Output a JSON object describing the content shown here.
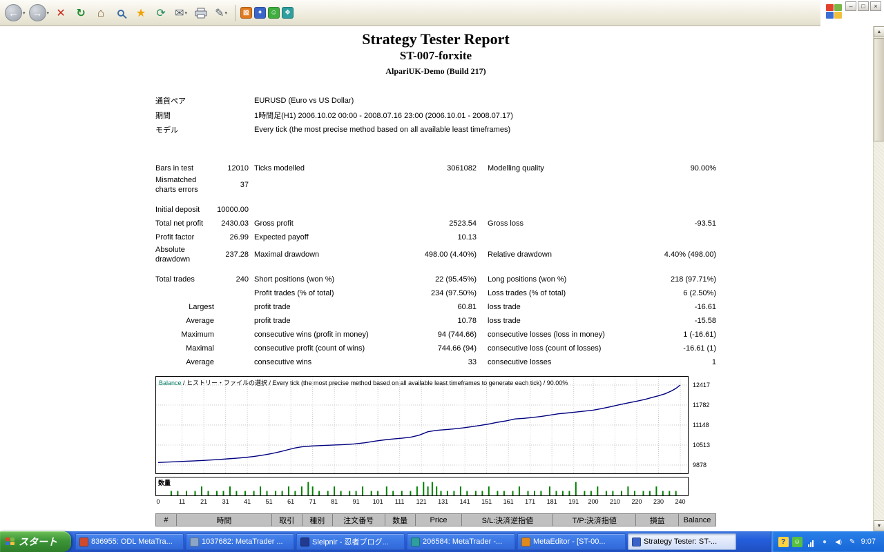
{
  "browser": {
    "toolbar_icons": [
      "back",
      "forward",
      "stop",
      "refresh",
      "home",
      "search",
      "favorites",
      "history",
      "mail",
      "print",
      "edit",
      "plugin-orange",
      "plugin-blue",
      "plugin-green",
      "plugin-teal"
    ],
    "window_controls": [
      "minimize",
      "maximize",
      "close"
    ]
  },
  "report": {
    "title": "Strategy Tester Report",
    "symbol": "ST-007-forxite",
    "server": "AlpariUK-Demo (Build 217)",
    "params": [
      {
        "label": "通貨ペア",
        "value": "EURUSD (Euro vs US Dollar)"
      },
      {
        "label": "期間",
        "value": "1時間足(H1) 2006.10.02 00:00 - 2008.07.16 23:00 (2006.10.01 - 2008.07.17)"
      },
      {
        "label": "モデル",
        "value": "Every tick (the most precise method based on all available least timeframes)"
      }
    ],
    "stats": [
      {
        "cells": [
          "Bars in test",
          "12010",
          "Ticks modelled",
          "3061082",
          "Modelling quality",
          "90.00%"
        ]
      },
      {
        "cells": [
          "Mismatched charts errors",
          "37",
          "",
          "",
          "",
          ""
        ]
      },
      {
        "spacer": true
      },
      {
        "cells": [
          "Initial deposit",
          "10000.00",
          "",
          "",
          "",
          ""
        ]
      },
      {
        "cells": [
          "Total net profit",
          "2430.03",
          "Gross profit",
          "2523.54",
          "Gross loss",
          "-93.51"
        ]
      },
      {
        "cells": [
          "Profit factor",
          "26.99",
          "Expected payoff",
          "10.13",
          "",
          ""
        ]
      },
      {
        "cells": [
          "Absolute drawdown",
          "237.28",
          "Maximal drawdown",
          "498.00 (4.40%)",
          "Relative drawdown",
          "4.40% (498.00)"
        ]
      },
      {
        "spacer": true
      },
      {
        "cells": [
          "Total trades",
          "240",
          "Short positions (won %)",
          "22 (95.45%)",
          "Long positions (won %)",
          "218 (97.71%)"
        ]
      },
      {
        "cells": [
          "",
          "",
          "Profit trades (% of total)",
          "234 (97.50%)",
          "Loss trades (% of total)",
          "6 (2.50%)"
        ]
      },
      {
        "cells": [
          "Largest",
          "",
          "profit trade",
          "60.81",
          "loss trade",
          "-16.61"
        ],
        "label_right": true
      },
      {
        "cells": [
          "Average",
          "",
          "profit trade",
          "10.78",
          "loss trade",
          "-15.58"
        ],
        "label_right": true
      },
      {
        "cells": [
          "Maximum",
          "",
          "consecutive wins (profit in money)",
          "94 (744.66)",
          "consecutive losses (loss in money)",
          "1 (-16.61)"
        ],
        "label_right": true
      },
      {
        "cells": [
          "Maximal",
          "",
          "consecutive profit (count of wins)",
          "744.66 (94)",
          "consecutive loss (count of losses)",
          "-16.61 (1)"
        ],
        "label_right": true
      },
      {
        "cells": [
          "Average",
          "",
          "consecutive wins",
          "33",
          "consecutive losses",
          "1"
        ],
        "label_right": true
      }
    ],
    "trades_header": [
      "#",
      "時間",
      "取引",
      "種別",
      "注文番号",
      "数量",
      "Price",
      "S/L:決済逆指値",
      "T/P:決済指値",
      "損益",
      "Balance"
    ]
  },
  "chart_data": {
    "type": "line",
    "legend_label": "Balance",
    "header_rest": " / ヒストリー・ファイルの選択 / Every tick (the most precise method based on all available least timeframes to generate each tick) / 90.00%",
    "line_color": "#000080",
    "grid": true,
    "ylim": [
      9878,
      12417
    ],
    "xlim": [
      0,
      240
    ],
    "y_ticks": [
      12417,
      11782,
      11148,
      10513,
      9878
    ],
    "x_ticks": [
      0,
      11,
      21,
      31,
      41,
      51,
      61,
      71,
      81,
      91,
      101,
      111,
      121,
      131,
      141,
      151,
      161,
      171,
      181,
      191,
      200,
      210,
      220,
      230,
      240
    ],
    "balance_points": [
      [
        0,
        9960
      ],
      [
        4,
        9972
      ],
      [
        8,
        9984
      ],
      [
        12,
        9996
      ],
      [
        16,
        10008
      ],
      [
        20,
        10022
      ],
      [
        24,
        10038
      ],
      [
        28,
        10055
      ],
      [
        32,
        10075
      ],
      [
        36,
        10095
      ],
      [
        40,
        10118
      ],
      [
        44,
        10150
      ],
      [
        48,
        10190
      ],
      [
        52,
        10240
      ],
      [
        56,
        10300
      ],
      [
        60,
        10370
      ],
      [
        63,
        10420
      ],
      [
        66,
        10455
      ],
      [
        70,
        10480
      ],
      [
        75,
        10498
      ],
      [
        80,
        10510
      ],
      [
        85,
        10525
      ],
      [
        90,
        10548
      ],
      [
        95,
        10585
      ],
      [
        100,
        10640
      ],
      [
        104,
        10678
      ],
      [
        108,
        10705
      ],
      [
        112,
        10730
      ],
      [
        116,
        10760
      ],
      [
        120,
        10825
      ],
      [
        124,
        10935
      ],
      [
        128,
        10980
      ],
      [
        132,
        11000
      ],
      [
        136,
        11025
      ],
      [
        140,
        11055
      ],
      [
        144,
        11095
      ],
      [
        148,
        11135
      ],
      [
        152,
        11180
      ],
      [
        156,
        11235
      ],
      [
        160,
        11280
      ],
      [
        164,
        11340
      ],
      [
        168,
        11360
      ],
      [
        172,
        11385
      ],
      [
        176,
        11420
      ],
      [
        180,
        11460
      ],
      [
        184,
        11505
      ],
      [
        188,
        11530
      ],
      [
        192,
        11560
      ],
      [
        196,
        11590
      ],
      [
        200,
        11620
      ],
      [
        204,
        11670
      ],
      [
        208,
        11730
      ],
      [
        212,
        11790
      ],
      [
        216,
        11850
      ],
      [
        220,
        11905
      ],
      [
        224,
        11965
      ],
      [
        227,
        12020
      ],
      [
        230,
        12075
      ],
      [
        233,
        12140
      ],
      [
        236,
        12230
      ],
      [
        238,
        12310
      ],
      [
        240,
        12417
      ]
    ],
    "volume_label": "数量",
    "volume_color": "#008000",
    "volume_bars": [
      [
        6,
        1
      ],
      [
        9,
        1
      ],
      [
        13,
        1
      ],
      [
        17,
        1
      ],
      [
        20,
        2
      ],
      [
        23,
        1
      ],
      [
        27,
        1
      ],
      [
        30,
        1
      ],
      [
        33,
        2
      ],
      [
        36,
        1
      ],
      [
        40,
        1
      ],
      [
        44,
        1
      ],
      [
        47,
        2
      ],
      [
        50,
        1
      ],
      [
        54,
        1
      ],
      [
        57,
        1
      ],
      [
        60,
        2
      ],
      [
        63,
        1
      ],
      [
        66,
        2
      ],
      [
        69,
        3
      ],
      [
        71,
        2
      ],
      [
        74,
        1
      ],
      [
        78,
        1
      ],
      [
        81,
        2
      ],
      [
        84,
        1
      ],
      [
        88,
        1
      ],
      [
        91,
        1
      ],
      [
        94,
        2
      ],
      [
        98,
        1
      ],
      [
        101,
        1
      ],
      [
        105,
        2
      ],
      [
        108,
        1
      ],
      [
        112,
        1
      ],
      [
        116,
        1
      ],
      [
        119,
        2
      ],
      [
        122,
        3
      ],
      [
        124,
        2
      ],
      [
        126,
        3
      ],
      [
        128,
        2
      ],
      [
        130,
        1
      ],
      [
        133,
        1
      ],
      [
        136,
        1
      ],
      [
        139,
        2
      ],
      [
        142,
        1
      ],
      [
        146,
        1
      ],
      [
        149,
        1
      ],
      [
        152,
        2
      ],
      [
        156,
        1
      ],
      [
        159,
        1
      ],
      [
        163,
        1
      ],
      [
        166,
        2
      ],
      [
        170,
        1
      ],
      [
        173,
        1
      ],
      [
        176,
        1
      ],
      [
        180,
        2
      ],
      [
        183,
        1
      ],
      [
        186,
        1
      ],
      [
        189,
        1
      ],
      [
        192,
        3
      ],
      [
        196,
        1
      ],
      [
        199,
        1
      ],
      [
        202,
        2
      ],
      [
        206,
        1
      ],
      [
        209,
        1
      ],
      [
        213,
        1
      ],
      [
        216,
        2
      ],
      [
        219,
        1
      ],
      [
        223,
        1
      ],
      [
        226,
        1
      ],
      [
        229,
        2
      ],
      [
        232,
        1
      ],
      [
        235,
        1
      ],
      [
        238,
        1
      ]
    ]
  },
  "taskbar": {
    "start_label": "スタート",
    "buttons": [
      {
        "label": "836955: ODL MetaTra...",
        "icon_color": "#cf4a2e",
        "active": false
      },
      {
        "label": "1037682: MetaTrader ...",
        "icon_color": "#8aa5c8",
        "active": false
      },
      {
        "label": "Sleipnir - 忍者ブログ...",
        "icon_color": "#223a8f",
        "active": false
      },
      {
        "label": "206584: MetaTrader -...",
        "icon_color": "#2e9e9e",
        "active": false
      },
      {
        "label": "MetaEditor - [ST-00...",
        "icon_color": "#e08a1e",
        "active": false
      },
      {
        "label": "Strategy Tester: ST-...",
        "icon_color": "#3a62c8",
        "active": true
      }
    ],
    "clock": "9:07"
  }
}
